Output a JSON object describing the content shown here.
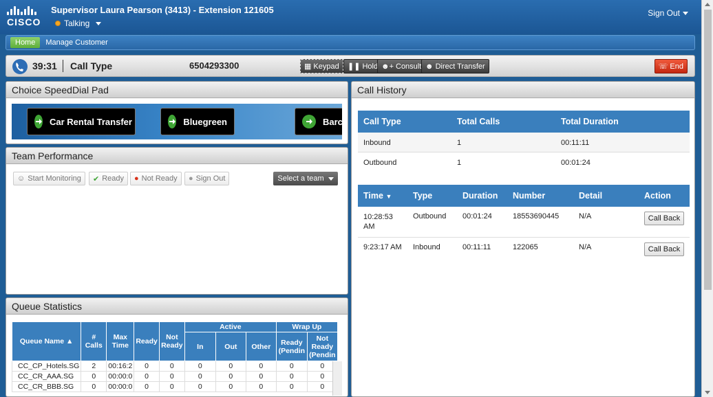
{
  "header": {
    "logo_text": "CISCO",
    "title": "Supervisor Laura Pearson (3413) - Extension 121605",
    "status": "Talking",
    "sign_out": "Sign Out"
  },
  "nav": {
    "home": "Home",
    "manage_customer": "Manage Customer"
  },
  "call": {
    "timer": "39:31",
    "call_type_label": "Call Type",
    "number": "6504293300",
    "keypad": "Keypad",
    "hold": "Hold",
    "consult": "Consult",
    "direct_transfer": "Direct Transfer",
    "end": "End"
  },
  "speeddial": {
    "title": "Choice SpeedDial Pad",
    "items": [
      "Car Rental Transfer",
      "Bluegreen",
      "Barcl"
    ]
  },
  "team": {
    "title": "Team Performance",
    "start_monitoring": "Start Monitoring",
    "ready": "Ready",
    "not_ready": "Not Ready",
    "sign_out": "Sign Out",
    "select_team": "Select a team"
  },
  "queue": {
    "title": "Queue Statistics",
    "headers": {
      "queue_name": "Queue Name",
      "calls": "# Calls",
      "max_time": "Max Time",
      "ready": "Ready",
      "not_ready": "Not Ready",
      "active": "Active",
      "in": "In",
      "out": "Out",
      "other": "Other",
      "wrap_up": "Wrap Up",
      "wrap_ready": "Ready (Pendin",
      "wrap_not_ready": "Not Ready (Pendin"
    },
    "rows": [
      {
        "name": "CC_CP_Hotels.SG",
        "calls": "2",
        "max": "00:16:2",
        "ready": "0",
        "not_ready": "0",
        "in": "0",
        "out": "0",
        "other": "0",
        "w_ready": "0",
        "w_not": "0"
      },
      {
        "name": "CC_CR_AAA.SG",
        "calls": "0",
        "max": "00:00:0",
        "ready": "0",
        "not_ready": "0",
        "in": "0",
        "out": "0",
        "other": "0",
        "w_ready": "0",
        "w_not": "0"
      },
      {
        "name": "CC_CR_BBB.SG",
        "calls": "0",
        "max": "00:00:0",
        "ready": "0",
        "not_ready": "0",
        "in": "0",
        "out": "0",
        "other": "0",
        "w_ready": "0",
        "w_not": "0"
      }
    ]
  },
  "history": {
    "title": "Call History",
    "summary_headers": [
      "Call Type",
      "Total Calls",
      "Total Duration"
    ],
    "summary_rows": [
      [
        "Inbound",
        "1",
        "00:11:11"
      ],
      [
        "Outbound",
        "1",
        "00:01:24"
      ]
    ],
    "detail_headers": [
      "Time",
      "Type",
      "Duration",
      "Number",
      "Detail",
      "Action"
    ],
    "detail_rows": [
      {
        "time": "10:28:53 AM",
        "type": "Outbound",
        "duration": "00:01:24",
        "number": "18553690445",
        "detail": "N/A",
        "action": "Call Back"
      },
      {
        "time": "9:23:17 AM",
        "type": "Inbound",
        "duration": "00:11:11",
        "number": "122065",
        "detail": "N/A",
        "action": "Call Back"
      }
    ]
  }
}
